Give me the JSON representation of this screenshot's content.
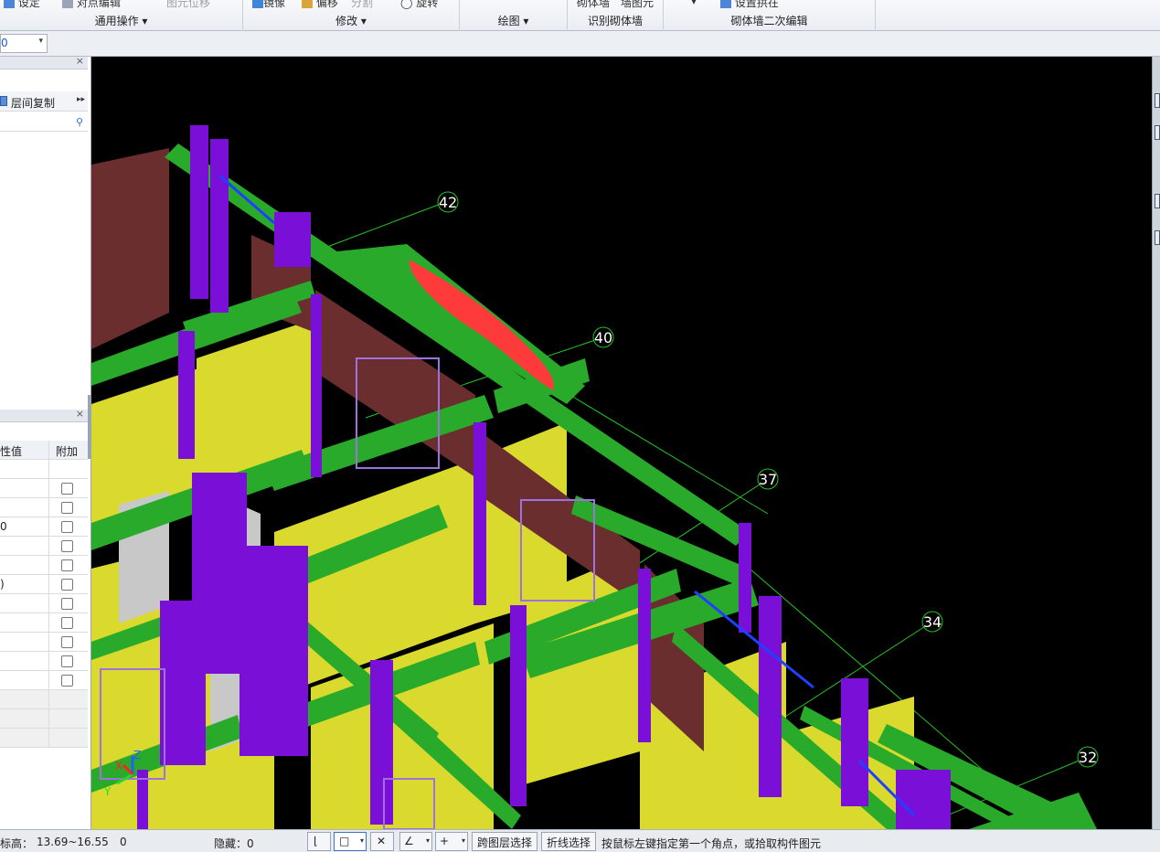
{
  "ribbon": {
    "groups": [
      {
        "label": "通用操作",
        "top_items": [
          "设定",
          "对点编辑",
          "图元位移"
        ]
      },
      {
        "label": "修改",
        "top_items": [
          "镜像",
          "偏移",
          "分割",
          "旋转"
        ]
      },
      {
        "label": "绘图",
        "top_items": []
      },
      {
        "label": "识别砌体墙",
        "top_items": [
          "砌体墙",
          "墙图元"
        ]
      },
      {
        "label": "砌体墙二次编辑",
        "top_items": [
          "设置拱在"
        ]
      }
    ]
  },
  "toolbar2": {
    "combo_value": "0"
  },
  "left_panel": {
    "copy_button": "层间复制",
    "columns": {
      "value": "性值",
      "extra": "附加"
    },
    "rows": [
      {
        "value": "",
        "checkbox": false
      },
      {
        "value": "",
        "checkbox": false
      },
      {
        "value": "0",
        "checkbox": false
      },
      {
        "value": "",
        "checkbox": false
      },
      {
        "value": "",
        "checkbox": false
      },
      {
        "value": ")",
        "checkbox": false
      },
      {
        "value": "",
        "checkbox": false
      },
      {
        "value": "",
        "checkbox": false
      },
      {
        "value": "",
        "checkbox": false
      },
      {
        "value": "",
        "checkbox": false
      },
      {
        "value": "",
        "checkbox": false
      },
      {
        "value": "",
        "checkbox": false
      },
      {
        "value": "",
        "checkbox": false
      },
      {
        "value": "",
        "checkbox": false
      }
    ]
  },
  "viewport": {
    "axis_labels": [
      "42",
      "40",
      "37",
      "34",
      "32"
    ],
    "colors": {
      "background": "#000000",
      "wall": "#dada2e",
      "beam": "#2aaa2a",
      "column": "#7a10d8",
      "brick": "#6a2e2e",
      "highlight": "#ff3a3a"
    }
  },
  "statusbar": {
    "elevation_label": "标高：",
    "elevation_value": "13.69~16.55",
    "count": "0",
    "hidden": "隐藏：0",
    "cross_layer": "跨图层选择",
    "polyline": "折线选择",
    "hint": "按鼠标左键指定第一个角点，或拾取构件图元"
  }
}
